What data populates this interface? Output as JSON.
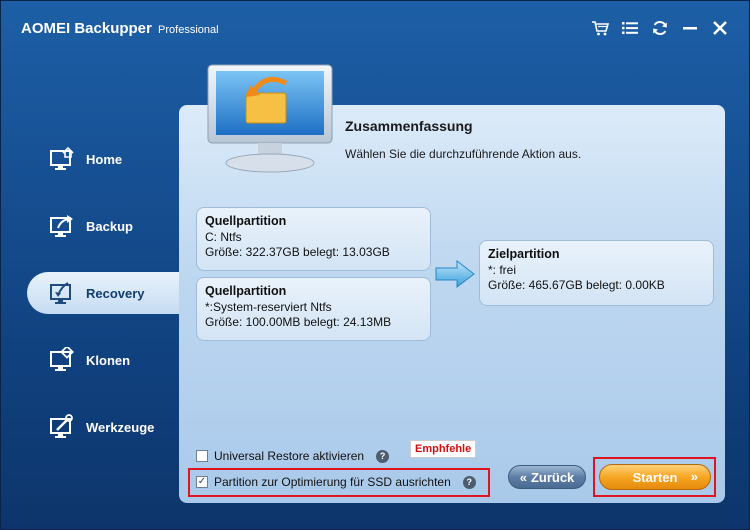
{
  "titlebar": {
    "app_name": "AOMEI Backupper",
    "edition": "Professional",
    "icons": [
      "cart-icon",
      "menu-icon",
      "refresh-icon",
      "minimize-icon",
      "close-icon"
    ]
  },
  "sidebar": {
    "items": [
      {
        "label": "Home",
        "icon": "home-icon",
        "active": false
      },
      {
        "label": "Backup",
        "icon": "backup-icon",
        "active": false
      },
      {
        "label": "Recovery",
        "icon": "recovery-icon",
        "active": true
      },
      {
        "label": "Klonen",
        "icon": "clone-icon",
        "active": false
      },
      {
        "label": "Werkzeuge",
        "icon": "tools-icon",
        "active": false
      }
    ]
  },
  "main": {
    "title": "Zusammenfassung",
    "subtitle": "Wählen Sie die durchzuführende Aktion aus.",
    "sources": [
      {
        "title": "Quellpartition",
        "line1": "C: Ntfs",
        "line2": "Größe: 322.37GB  belegt: 13.03GB"
      },
      {
        "title": "Quellpartition",
        "line1": "*:System-reserviert Ntfs",
        "line2": "Größe: 100.00MB  belegt: 24.13MB"
      }
    ],
    "target": {
      "title": "Zielpartition",
      "line1": "*: frei",
      "line2": "Größe: 465.67GB  belegt: 0.00KB"
    },
    "options": {
      "universal_restore": {
        "label": "Universal Restore aktivieren",
        "checked": false
      },
      "ssd_align": {
        "label": "Partition zur Optimierung für SSD ausrichten",
        "checked": true
      }
    },
    "recommend_note": "Emphfehle",
    "back_label": "Zurück",
    "start_label": "Starten"
  },
  "colors": {
    "highlight": "#e0141e",
    "start_button": "#f6a623",
    "background": "#164f92"
  }
}
